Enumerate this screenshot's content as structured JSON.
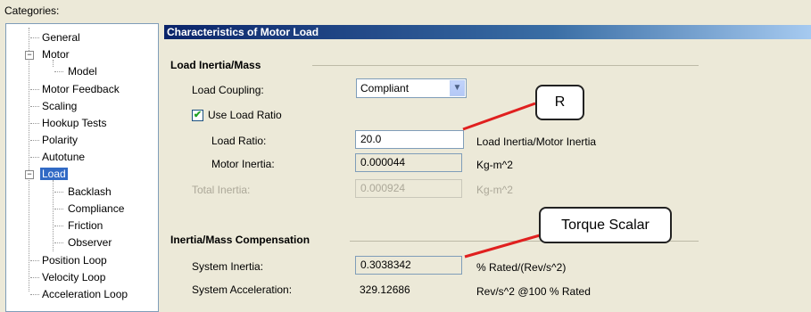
{
  "categories_label": "Categories:",
  "tree": {
    "items": [
      {
        "label": "General"
      },
      {
        "label": "Motor"
      },
      {
        "label": "Model"
      },
      {
        "label": "Motor Feedback"
      },
      {
        "label": "Scaling"
      },
      {
        "label": "Hookup Tests"
      },
      {
        "label": "Polarity"
      },
      {
        "label": "Autotune"
      },
      {
        "label": "Load"
      },
      {
        "label": "Backlash"
      },
      {
        "label": "Compliance"
      },
      {
        "label": "Friction"
      },
      {
        "label": "Observer"
      },
      {
        "label": "Position Loop"
      },
      {
        "label": "Velocity Loop"
      },
      {
        "label": "Acceleration Loop"
      }
    ]
  },
  "panel": {
    "title": "Characteristics of Motor Load",
    "inertia_group": {
      "title": "Load Inertia/Mass",
      "load_coupling_label": "Load Coupling:",
      "load_coupling_value": "Compliant",
      "use_load_ratio_label": "Use Load Ratio",
      "load_ratio_label": "Load Ratio:",
      "load_ratio_value": "20.0",
      "load_ratio_unit": "Load Inertia/Motor Inertia",
      "motor_inertia_label": "Motor Inertia:",
      "motor_inertia_value": "0.000044",
      "motor_inertia_unit": "Kg-m^2",
      "total_inertia_label": "Total Inertia:",
      "total_inertia_value": "0.000924",
      "total_inertia_unit": "Kg-m^2"
    },
    "compensation_group": {
      "title": "Inertia/Mass Compensation",
      "system_inertia_label": "System Inertia:",
      "system_inertia_value": "0.3038342",
      "system_inertia_unit": "% Rated/(Rev/s^2)",
      "system_accel_label": "System Acceleration:",
      "system_accel_value": "329.12686",
      "system_accel_unit": "Rev/s^2 @100 % Rated"
    }
  },
  "callouts": {
    "r": "R",
    "torque_scalar": "Torque Scalar"
  },
  "colors": {
    "callout_line": "#e0201f",
    "selection": "#316ac5"
  }
}
